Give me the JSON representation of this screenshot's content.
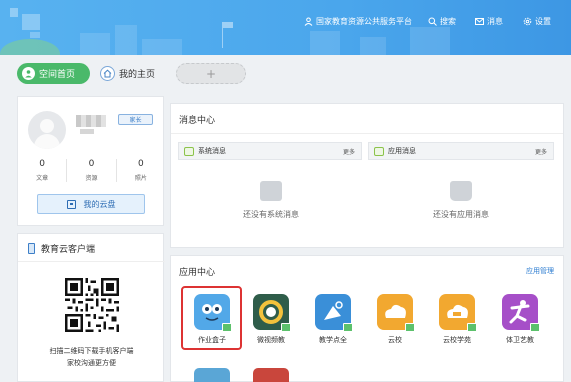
{
  "header": {
    "nav": [
      {
        "label": "国家教育资源公共服务平台",
        "icon": "user-icon"
      },
      {
        "label": "搜索",
        "icon": "search-icon"
      },
      {
        "label": "消息",
        "icon": "mail-icon"
      },
      {
        "label": "设置",
        "icon": "gear-icon"
      }
    ]
  },
  "tabs": {
    "home": "空间首页",
    "my": "我的主页",
    "add": "+"
  },
  "profile": {
    "role": "家长",
    "stats": [
      {
        "value": "0",
        "label": "文章"
      },
      {
        "value": "0",
        "label": "资源"
      },
      {
        "value": "0",
        "label": "照片"
      }
    ],
    "cloud_label": "我的云盘"
  },
  "client": {
    "title": "教育云客户端",
    "caption_line1": "扫描二维码下载手机客户端",
    "caption_line2": "家校沟通更方便"
  },
  "messages": {
    "title": "消息中心",
    "system_tab": "系统消息",
    "app_tab": "应用消息",
    "more": "更多",
    "system_empty": "还没有系统消息",
    "app_empty": "还没有应用消息"
  },
  "apps": {
    "title": "应用中心",
    "manage": "应用管理",
    "items": [
      {
        "label": "作业盒子",
        "color": "#52a8e8"
      },
      {
        "label": "微视频教",
        "color": "#2f5d4a"
      },
      {
        "label": "教学点全",
        "color": "#3a8fd8"
      },
      {
        "label": "云校",
        "color": "#f2a830"
      },
      {
        "label": "云校学苑",
        "color": "#f2a830"
      },
      {
        "label": "体卫艺教",
        "color": "#a64fc8"
      }
    ],
    "highlight_color": "#dd3333"
  }
}
